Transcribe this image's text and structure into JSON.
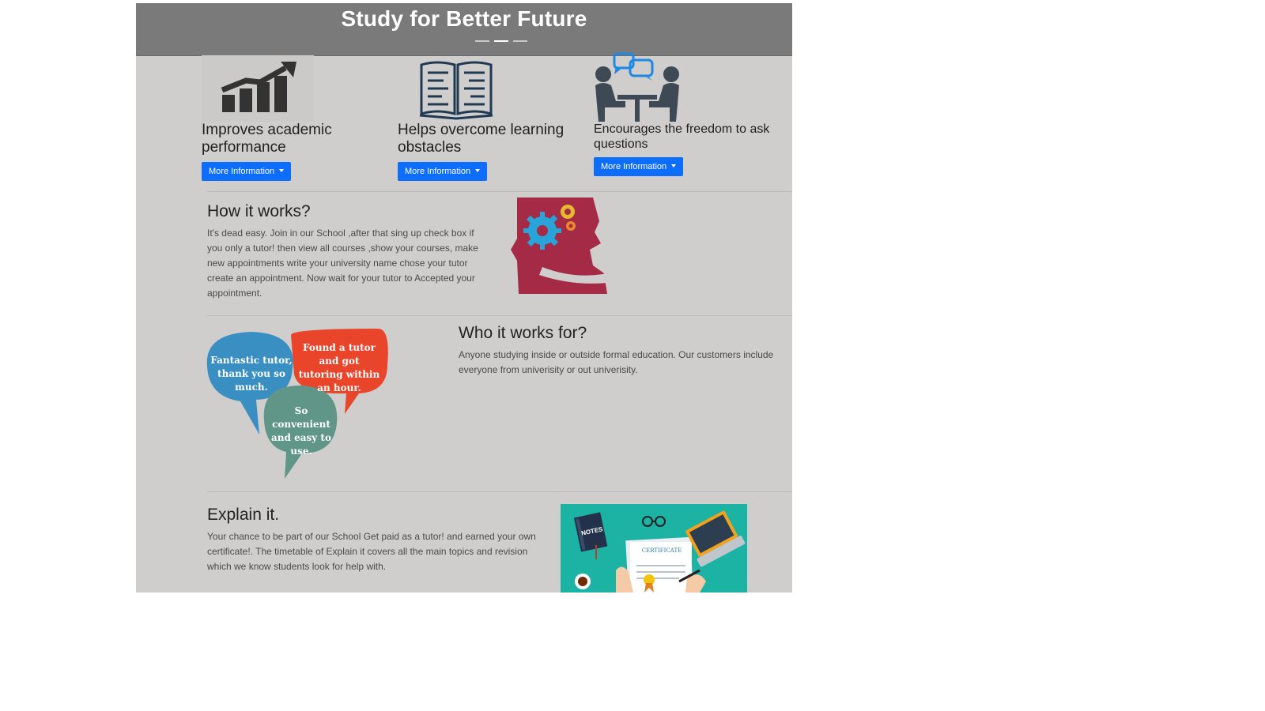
{
  "hero": {
    "title": "Study for Better Future",
    "indicators": [
      "slide-1",
      "slide-2",
      "slide-3"
    ],
    "active_indicator": 2
  },
  "features": [
    {
      "title": "Improves academic performance",
      "button": "More Information",
      "icon": "bar-chart-growth-icon"
    },
    {
      "title": "Helps overcome learning obstacles",
      "button": "More Information",
      "icon": "open-book-icon"
    },
    {
      "title": "Encourages the freedom to ask questions",
      "button": "More Information",
      "icon": "people-talking-icon"
    }
  ],
  "how": {
    "title": "How it works?",
    "text": "It's dead easy. Join in our School ,after that sing up check box if you only a tutor! then view all courses ,show your courses, make new appointments write your university name chose your tutor create an appointment. Now wait for your tutor to Accepted your appointment."
  },
  "who": {
    "title": "Who it works for?",
    "text": "Anyone studying inside or outside formal education. Our customers include everyone from univerisity or out univerisity.",
    "bubbles": [
      {
        "text": "Fantastic tutor, thank you so much.",
        "color": "#3a8fc2"
      },
      {
        "text": "Found a tutor and got tutoring within an hour.",
        "color": "#e8452b"
      },
      {
        "text": "So convenient and easy to use.",
        "color": "#5f9688"
      }
    ]
  },
  "explain": {
    "title": "Explain it.",
    "text": "Your chance to be part of our School Get paid as a tutor! and earned your own certificate!. The timetable of Explain it covers all the main topics and revision which we know students look for help with.",
    "notes_label": "NOTES",
    "certificate_label": "CERTIFICATE"
  },
  "colors": {
    "page_bg": "#cfcecd",
    "hero_bg": "#7a7a7a",
    "button": "#0d6efd",
    "icon_dark": "#333333",
    "icon_navy": "#1f3a52",
    "chat_blue": "#1e88e5",
    "head_red": "#a52a46",
    "teal": "#1cb2a4"
  }
}
